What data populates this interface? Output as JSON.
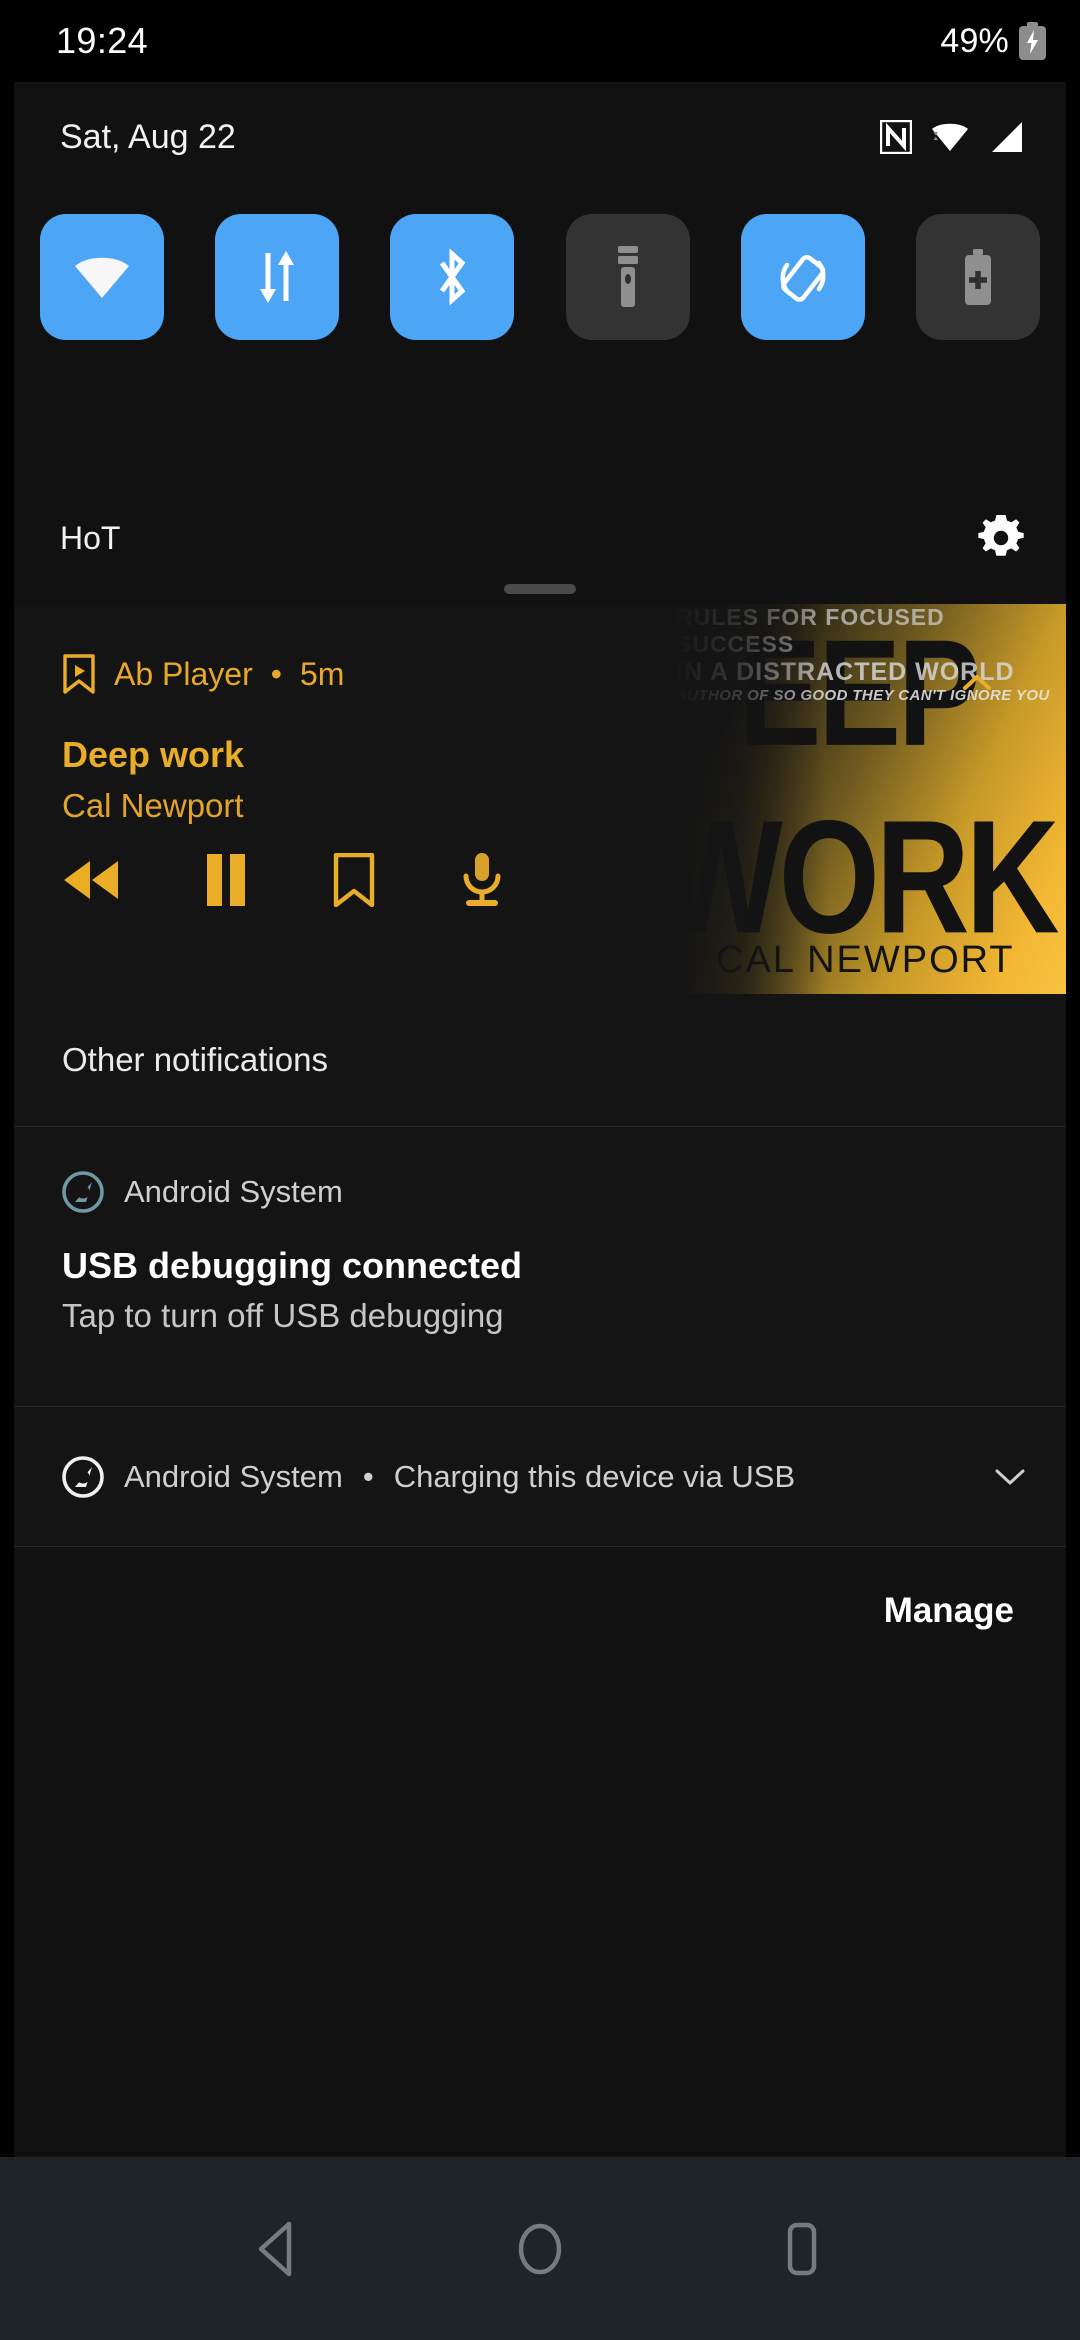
{
  "status_bar": {
    "clock": "19:24",
    "battery_percent": "49%",
    "battery_icon": "battery-charging-icon"
  },
  "shade": {
    "date": "Sat, Aug 22",
    "status_icons": [
      "nfc-icon",
      "wifi-icon",
      "signal-icon"
    ],
    "carrier": "HoT",
    "settings_icon": "gear-icon",
    "drag_handle": "drag-handle",
    "tiles": [
      {
        "name": "wifi-tile",
        "icon": "wifi-icon",
        "state": "on"
      },
      {
        "name": "mobile-data-tile",
        "icon": "data-arrows-icon",
        "state": "on"
      },
      {
        "name": "bluetooth-tile",
        "icon": "bluetooth-icon",
        "state": "on"
      },
      {
        "name": "flashlight-tile",
        "icon": "flashlight-icon",
        "state": "off"
      },
      {
        "name": "auto-rotate-tile",
        "icon": "auto-rotate-icon",
        "state": "on"
      },
      {
        "name": "battery-saver-tile",
        "icon": "battery-plus-icon",
        "state": "off"
      }
    ],
    "tile_on_color": "#4da6f5",
    "tile_off_color": "#333333"
  },
  "media": {
    "app_name": "Ab Player",
    "separator": "•",
    "elapsed": "5m",
    "title": "Deep work",
    "artist": "Cal Newport",
    "accent_color": "#e9ad27",
    "app_icon": "bookmark-play-icon",
    "collapse_icon": "chevron-up-icon",
    "controls": [
      {
        "name": "rewind-button",
        "icon": "rewind-icon"
      },
      {
        "name": "pause-button",
        "icon": "pause-icon"
      },
      {
        "name": "bookmark-button",
        "icon": "bookmark-icon"
      },
      {
        "name": "voice-button",
        "icon": "microphone-icon"
      }
    ],
    "album_art": {
      "title_line1": "DEEP",
      "title_line2": "WORK",
      "subtitle_line1": "RULES FOR FOCUSED SUCCESS",
      "subtitle_line2": "IN A DISTRACTED WORLD",
      "author": "CAL NEWPORT",
      "tagline": "AUTHOR OF SO GOOD THEY CAN'T IGNORE YOU"
    }
  },
  "notifications": {
    "section_header": "Other notifications",
    "items": [
      {
        "app": "Android System",
        "app_icon": "android-system-icon",
        "title": "USB debugging connected",
        "body": "Tap to turn off USB debugging"
      },
      {
        "app": "Android System",
        "separator": "•",
        "summary": "Charging this device via USB",
        "app_icon": "android-system-icon",
        "expand_icon": "chevron-down-icon"
      }
    ],
    "manage_label": "Manage"
  },
  "nav_bar": {
    "back": "back-icon",
    "home": "home-icon",
    "recents": "recents-icon"
  }
}
